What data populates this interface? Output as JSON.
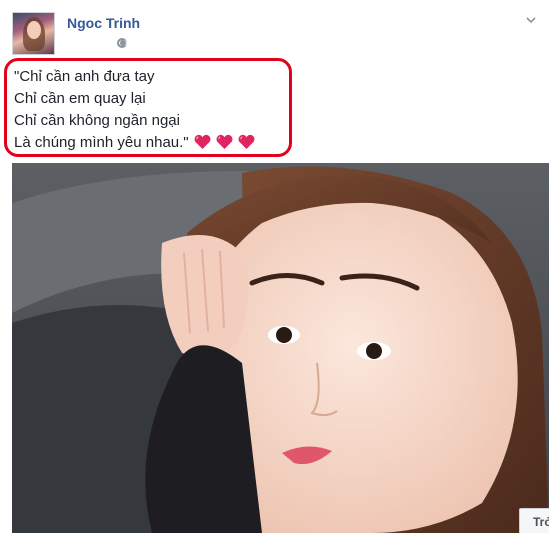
{
  "post": {
    "author": "Ngoc Trinh",
    "privacy_icon": "globe-icon",
    "message_lines": [
      "\"Chỉ cần anh đưa tay",
      "Chỉ cần em quay lại",
      "Chỉ cần không ngần ngại",
      "Là chúng mình yêu nhau.\""
    ],
    "emoji": "heart-icon",
    "emoji_count": 3,
    "highlight_color": "#e3001b",
    "photo_button_label": "Trở"
  },
  "colors": {
    "author_link": "#365899",
    "text": "#1d2129",
    "heart": "#e0245e"
  }
}
